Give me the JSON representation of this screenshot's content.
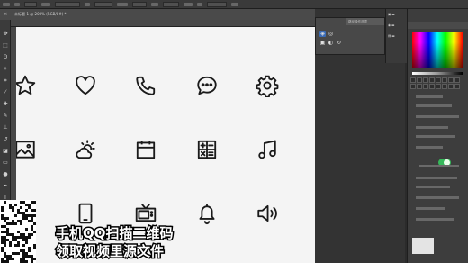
{
  "document": {
    "tab_title": "未标题-1 @ 200% (RGB/8#) *",
    "close_glyph": "×"
  },
  "toolbar": {
    "tools": [
      {
        "name": "move-tool-icon",
        "glyph": "✥"
      },
      {
        "name": "marquee-tool-icon",
        "glyph": "⬚"
      },
      {
        "name": "lasso-tool-icon",
        "glyph": "ʘ"
      },
      {
        "name": "magic-wand-tool-icon",
        "glyph": "✧"
      },
      {
        "name": "crop-tool-icon",
        "glyph": "⌗"
      },
      {
        "name": "eyedropper-tool-icon",
        "glyph": "⁄"
      },
      {
        "name": "healing-brush-tool-icon",
        "glyph": "✚"
      },
      {
        "name": "brush-tool-icon",
        "glyph": "✎"
      },
      {
        "name": "clone-stamp-tool-icon",
        "glyph": "⊥"
      },
      {
        "name": "history-brush-tool-icon",
        "glyph": "↺"
      },
      {
        "name": "eraser-tool-icon",
        "glyph": "◪"
      },
      {
        "name": "gradient-tool-icon",
        "glyph": "▭"
      },
      {
        "name": "dodge-tool-icon",
        "glyph": "●"
      },
      {
        "name": "pen-tool-icon",
        "glyph": "✒"
      },
      {
        "name": "type-tool-icon",
        "glyph": "T"
      },
      {
        "name": "path-selection-tool-icon",
        "glyph": "➤"
      },
      {
        "name": "shape-tool-icon",
        "glyph": "▢"
      },
      {
        "name": "hand-tool-icon",
        "glyph": "✋"
      },
      {
        "name": "zoom-tool-icon",
        "glyph": "⌕"
      }
    ]
  },
  "canvas_icons": [
    {
      "name": "star-icon"
    },
    {
      "name": "heart-icon"
    },
    {
      "name": "phone-icon"
    },
    {
      "name": "chat-bubble-icon"
    },
    {
      "name": "gear-icon"
    },
    {
      "name": "camera-icon"
    },
    {
      "name": "image-icon"
    },
    {
      "name": "partly-cloudy-icon"
    },
    {
      "name": "calendar-icon"
    },
    {
      "name": "calculator-icon"
    },
    {
      "name": "music-note-icon"
    },
    {
      "name": "play-icon"
    },
    {
      "name": "microphone-icon"
    },
    {
      "name": "mobile-phone-icon"
    },
    {
      "name": "tv-icon"
    },
    {
      "name": "bell-icon"
    },
    {
      "name": "speaker-icon"
    },
    {
      "name": "user-icon"
    }
  ],
  "popup_panel": {
    "title": "路径操作选项",
    "button_glyphs": [
      "◈",
      "◎",
      "▣",
      "◐",
      "↻"
    ]
  },
  "overlay": {
    "line1": "手机QQ扫描二维码",
    "line2": "领取视频里源文件"
  },
  "colors": {
    "workspace": "#2b2b2b",
    "canvas": "#f4f4f4",
    "icon_stroke": "#1a1a1a",
    "toggle_on": "#35b85a",
    "selection_highlight": "#3a6bb5"
  }
}
